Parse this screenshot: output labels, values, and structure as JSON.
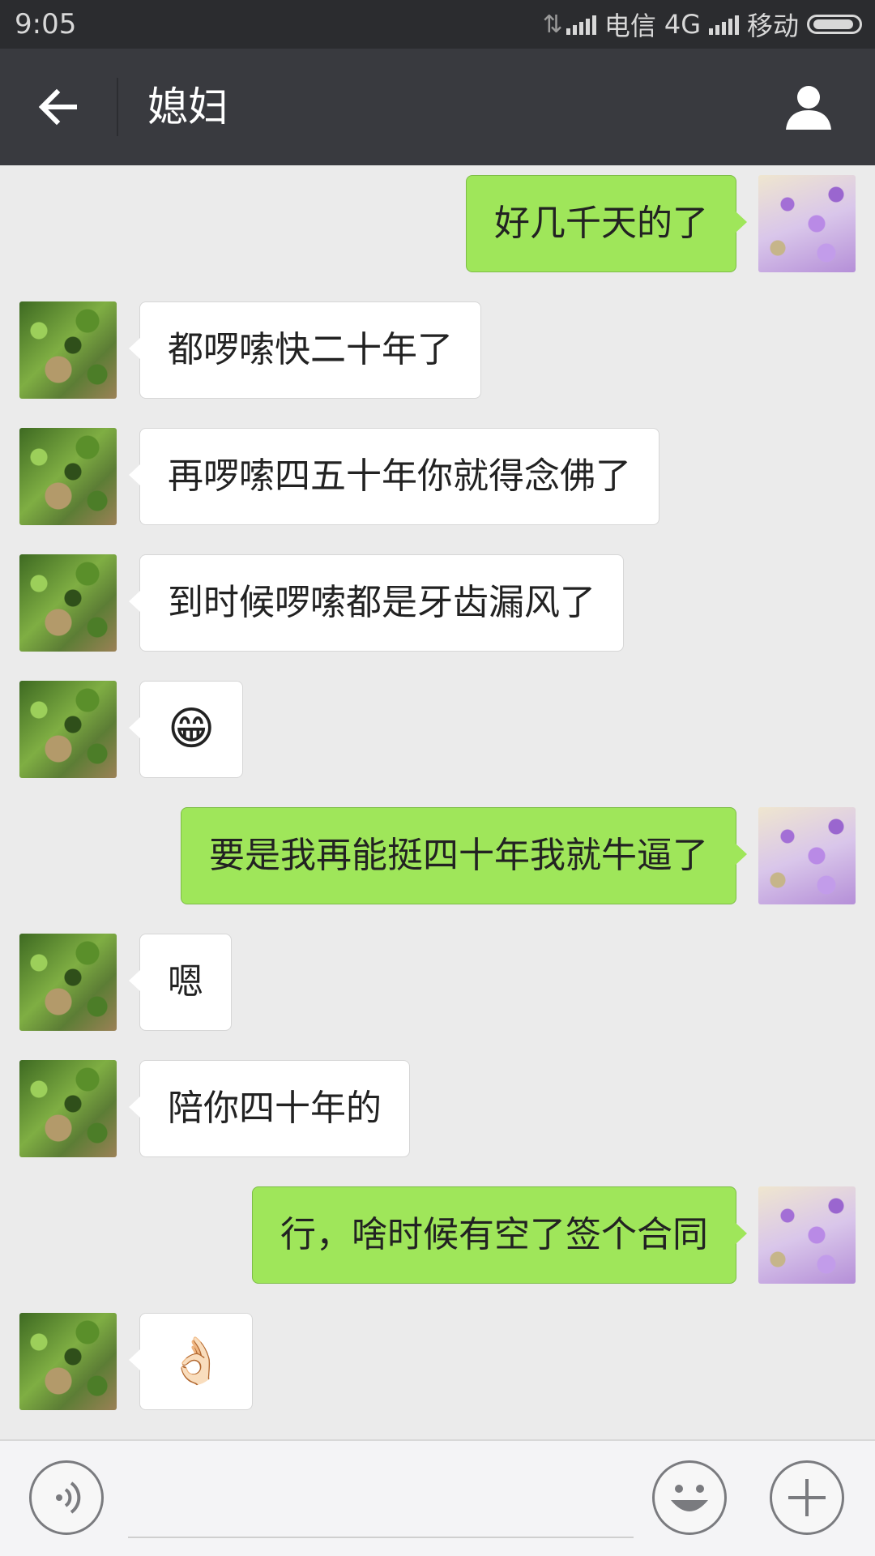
{
  "status_bar": {
    "time": "9:05",
    "carrier1": "电信",
    "network": "4G",
    "carrier2": "移动"
  },
  "header": {
    "title": "媳妇",
    "back_icon": "back-arrow-icon",
    "profile_icon": "person-icon"
  },
  "messages": [
    {
      "side": "self",
      "text": "好几千天的了"
    },
    {
      "side": "other",
      "text": "都啰嗦快二十年了"
    },
    {
      "side": "other",
      "text": "再啰嗦四五十年你就得念佛了"
    },
    {
      "side": "other",
      "text": "到时候啰嗦都是牙齿漏风了"
    },
    {
      "side": "other",
      "text": "😁"
    },
    {
      "side": "self",
      "text": "要是我再能挺四十年我就牛逼了"
    },
    {
      "side": "other",
      "text": "嗯"
    },
    {
      "side": "other",
      "text": "陪你四十年的"
    },
    {
      "side": "self",
      "text": "行，啥时候有空了签个合同"
    },
    {
      "side": "other",
      "text": "👌🏻"
    }
  ],
  "input_bar": {
    "voice_icon": "voice-icon",
    "emoji_icon": "smiley-icon",
    "plus_icon": "plus-icon",
    "input_value": "",
    "input_placeholder": ""
  },
  "colors": {
    "sent_bubble": "#9fe65a",
    "received_bubble": "#ffffff",
    "header_bg": "#393a3f",
    "status_bg": "#2b2c2f",
    "chat_bg": "#ebebeb"
  }
}
